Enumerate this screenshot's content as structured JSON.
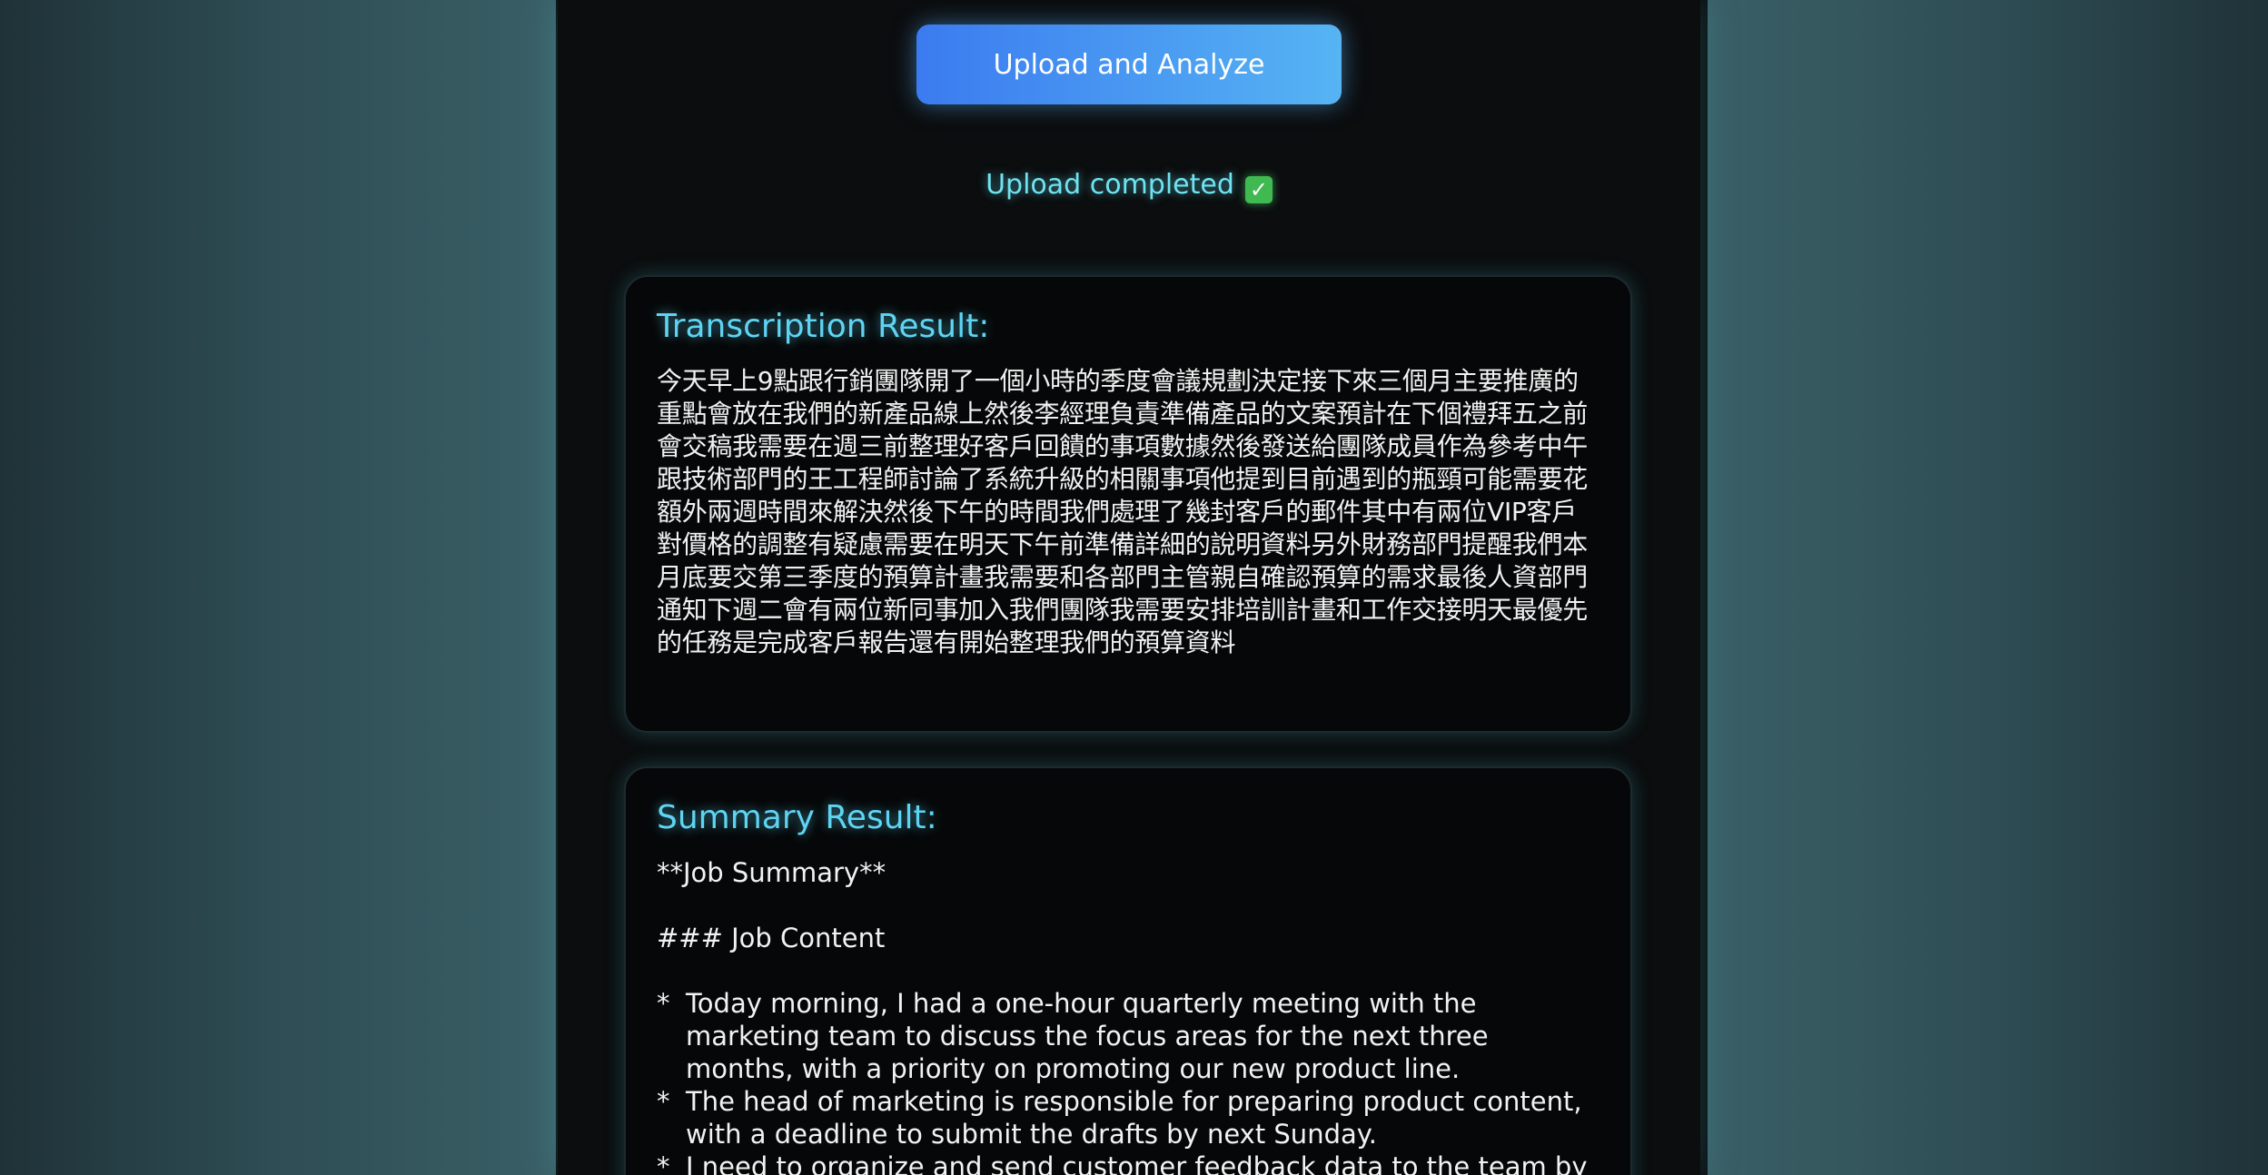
{
  "upload_button": {
    "label": "Upload and Analyze"
  },
  "status": {
    "text": "Upload completed",
    "check_icon": "✓"
  },
  "transcription": {
    "title": "Transcription Result:",
    "text": "今天早上9點跟行銷團隊開了一個小時的季度會議規劃決定接下來三個月主要推廣的重點會放在我們的新產品線上然後李經理負責準備產品的文案預計在下個禮拜五之前會交稿我需要在週三前整理好客戶回饋的事項數據然後發送給團隊成員作為參考中午跟技術部門的王工程師討論了系統升級的相關事項他提到目前遇到的瓶頸可能需要花額外兩週時間來解決然後下午的時間我們處理了幾封客戶的郵件其中有兩位VIP客戶對價格的調整有疑慮需要在明天下午前準備詳細的說明資料另外財務部門提醒我們本月底要交第三季度的預算計畫我需要和各部門主管親自確認預算的需求最後人資部門通知下週二會有兩位新同事加入我們團隊我需要安排培訓計畫和工作交接明天最優先的任務是完成客戶報告還有開始整理我們的預算資料"
  },
  "summary": {
    "title": "Summary Result:",
    "heading": "**Job Summary**",
    "section": "### Job Content",
    "bullet_marker": "*",
    "bullets": [
      "Today morning, I had a one-hour quarterly meeting with the marketing team to discuss the focus areas for the next three months, with a priority on promoting our new product line.",
      "The head of marketing is responsible for preparing product content, with a deadline to submit the drafts by next Sunday.",
      "I need to organize and send customer feedback data to the team by this Wednesday."
    ]
  }
}
